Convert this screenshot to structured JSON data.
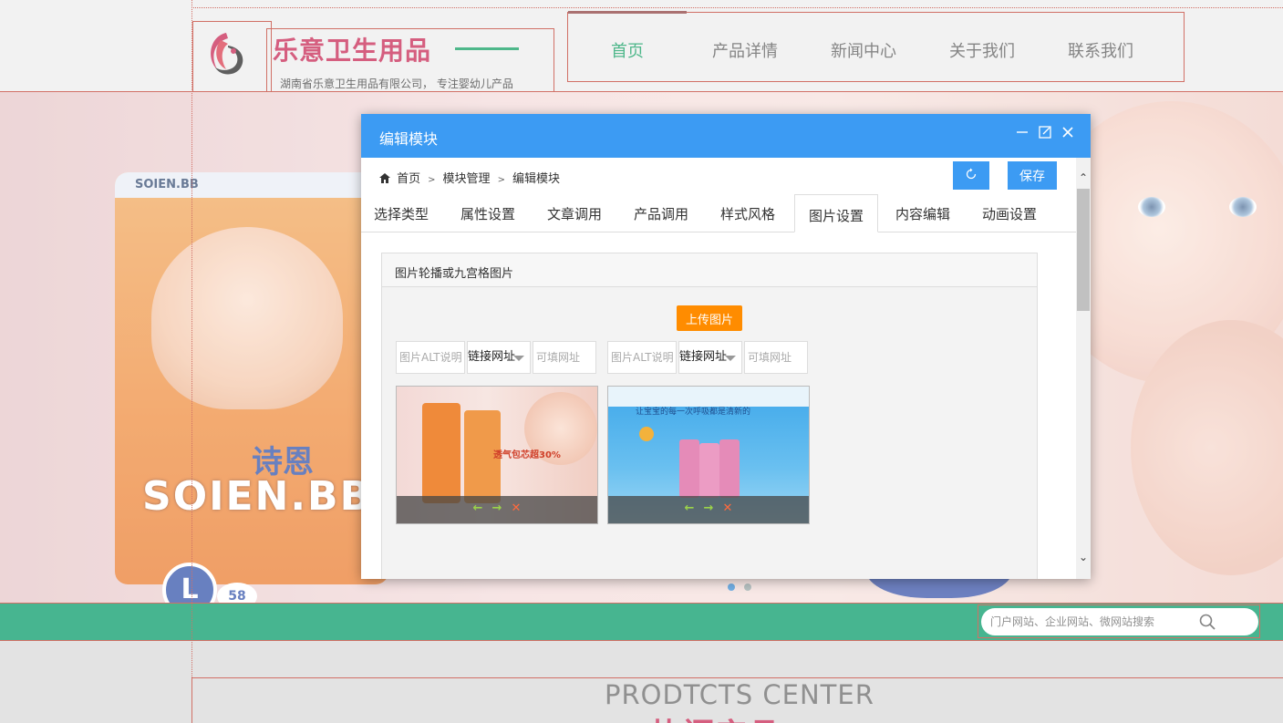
{
  "site": {
    "brand_title": "乐意卫生用品",
    "brand_subtitle": "湖南省乐意卫生用品有限公司， 专注婴幼儿产品",
    "nav": [
      {
        "label": "首页",
        "active": true
      },
      {
        "label": "产品详情",
        "active": false
      },
      {
        "label": "新闻中心",
        "active": false
      },
      {
        "label": "关于我们",
        "active": false
      },
      {
        "label": "联系我们",
        "active": false
      }
    ],
    "banner": {
      "pack_brand": "SOIEN.BB",
      "pack_cn": "诗恩",
      "pack_top": "SOIEN.BB",
      "pack_size": "L",
      "pack_count": "58"
    },
    "search": {
      "placeholder": "门户网站、企业网站、微网站搜索"
    },
    "section_en": "PRODTCTS CENTER",
    "section_cn": "热门产品"
  },
  "modal": {
    "title": "编辑模块",
    "breadcrumb": [
      "首页",
      "模块管理",
      "编辑模块"
    ],
    "save_label": "保存",
    "tabs": [
      {
        "label": "选择类型",
        "active": false
      },
      {
        "label": "属性设置",
        "active": false
      },
      {
        "label": "文章调用",
        "active": false
      },
      {
        "label": "产品调用",
        "active": false
      },
      {
        "label": "样式风格",
        "active": false
      },
      {
        "label": "图片设置",
        "active": true
      },
      {
        "label": "内容编辑",
        "active": false
      },
      {
        "label": "动画设置",
        "active": false
      }
    ],
    "panel_title": "图片轮播或九宫格图片",
    "upload_label": "上传图片",
    "images": [
      {
        "alt_placeholder": "图片ALT说明",
        "link_type": "链接网址",
        "url_placeholder": "可填网址",
        "thumb_text": "透气包芯超30%"
      },
      {
        "alt_placeholder": "图片ALT说明",
        "link_type": "链接网址",
        "url_placeholder": "可填网址",
        "thumb_text": "让宝宝的每一次呼吸都是清新的"
      }
    ]
  },
  "colors": {
    "accent_blue": "#3c9bf3",
    "brand_green": "#009966",
    "brand_red": "#c5204e",
    "upload_orange": "#ff8c00"
  }
}
